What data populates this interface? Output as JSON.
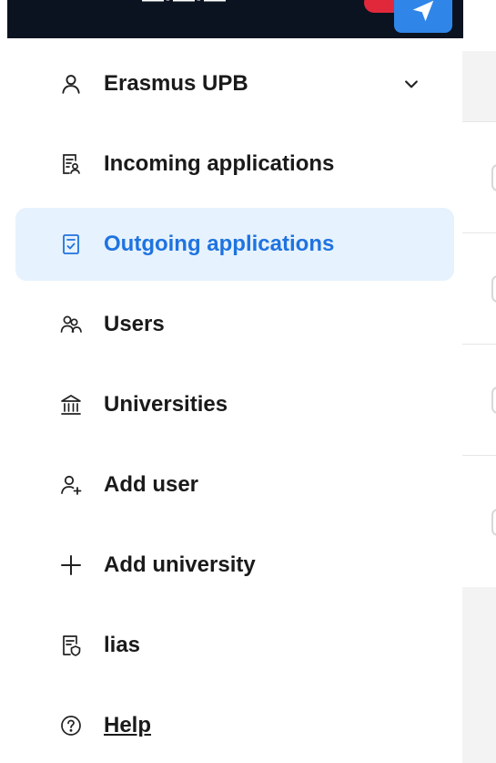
{
  "menu": {
    "account": {
      "label": "Erasmus UPB",
      "icon": "user-icon",
      "expanded": false
    },
    "items": [
      {
        "label": "Incoming applications",
        "icon": "incoming-applications-icon",
        "active": false
      },
      {
        "label": "Outgoing applications",
        "icon": "outgoing-applications-icon",
        "active": true
      },
      {
        "label": "Users",
        "icon": "users-icon",
        "active": false
      },
      {
        "label": "Universities",
        "icon": "university-icon",
        "active": false
      },
      {
        "label": "Add user",
        "icon": "add-user-icon",
        "active": false
      },
      {
        "label": "Add university",
        "icon": "plus-icon",
        "active": false
      },
      {
        "label": "lias",
        "icon": "document-shield-icon",
        "active": false
      },
      {
        "label": "Help",
        "icon": "help-icon",
        "active": false
      }
    ]
  },
  "colors": {
    "active_bg": "#e6f2fd",
    "active_text": "#1f73e0",
    "topbar_bg": "#0b1320",
    "accent": "#2f86e8",
    "notification": "#e0283a"
  }
}
